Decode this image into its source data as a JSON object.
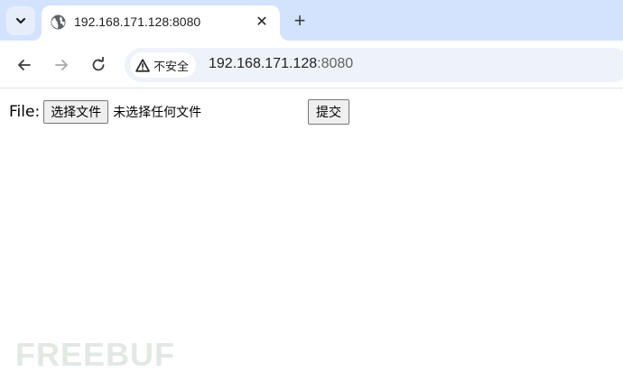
{
  "tab": {
    "title": "192.168.171.128:8080",
    "close_glyph": "✕",
    "new_tab_glyph": "+"
  },
  "toolbar": {
    "security_label": "不安全",
    "url_host": "192.168.171.128",
    "url_port": ":8080"
  },
  "form": {
    "file_label": "File:",
    "choose_file_button": "选择文件",
    "file_status": "未选择任何文件",
    "submit_button": "提交"
  },
  "watermark": {
    "text": "FREEBUF"
  },
  "icons": {
    "tab_search": "chevron-down-icon",
    "favicon": "globe-icon",
    "back": "arrow-left-icon",
    "forward": "arrow-right-icon",
    "reload": "reload-icon",
    "security": "warning-triangle-icon"
  }
}
